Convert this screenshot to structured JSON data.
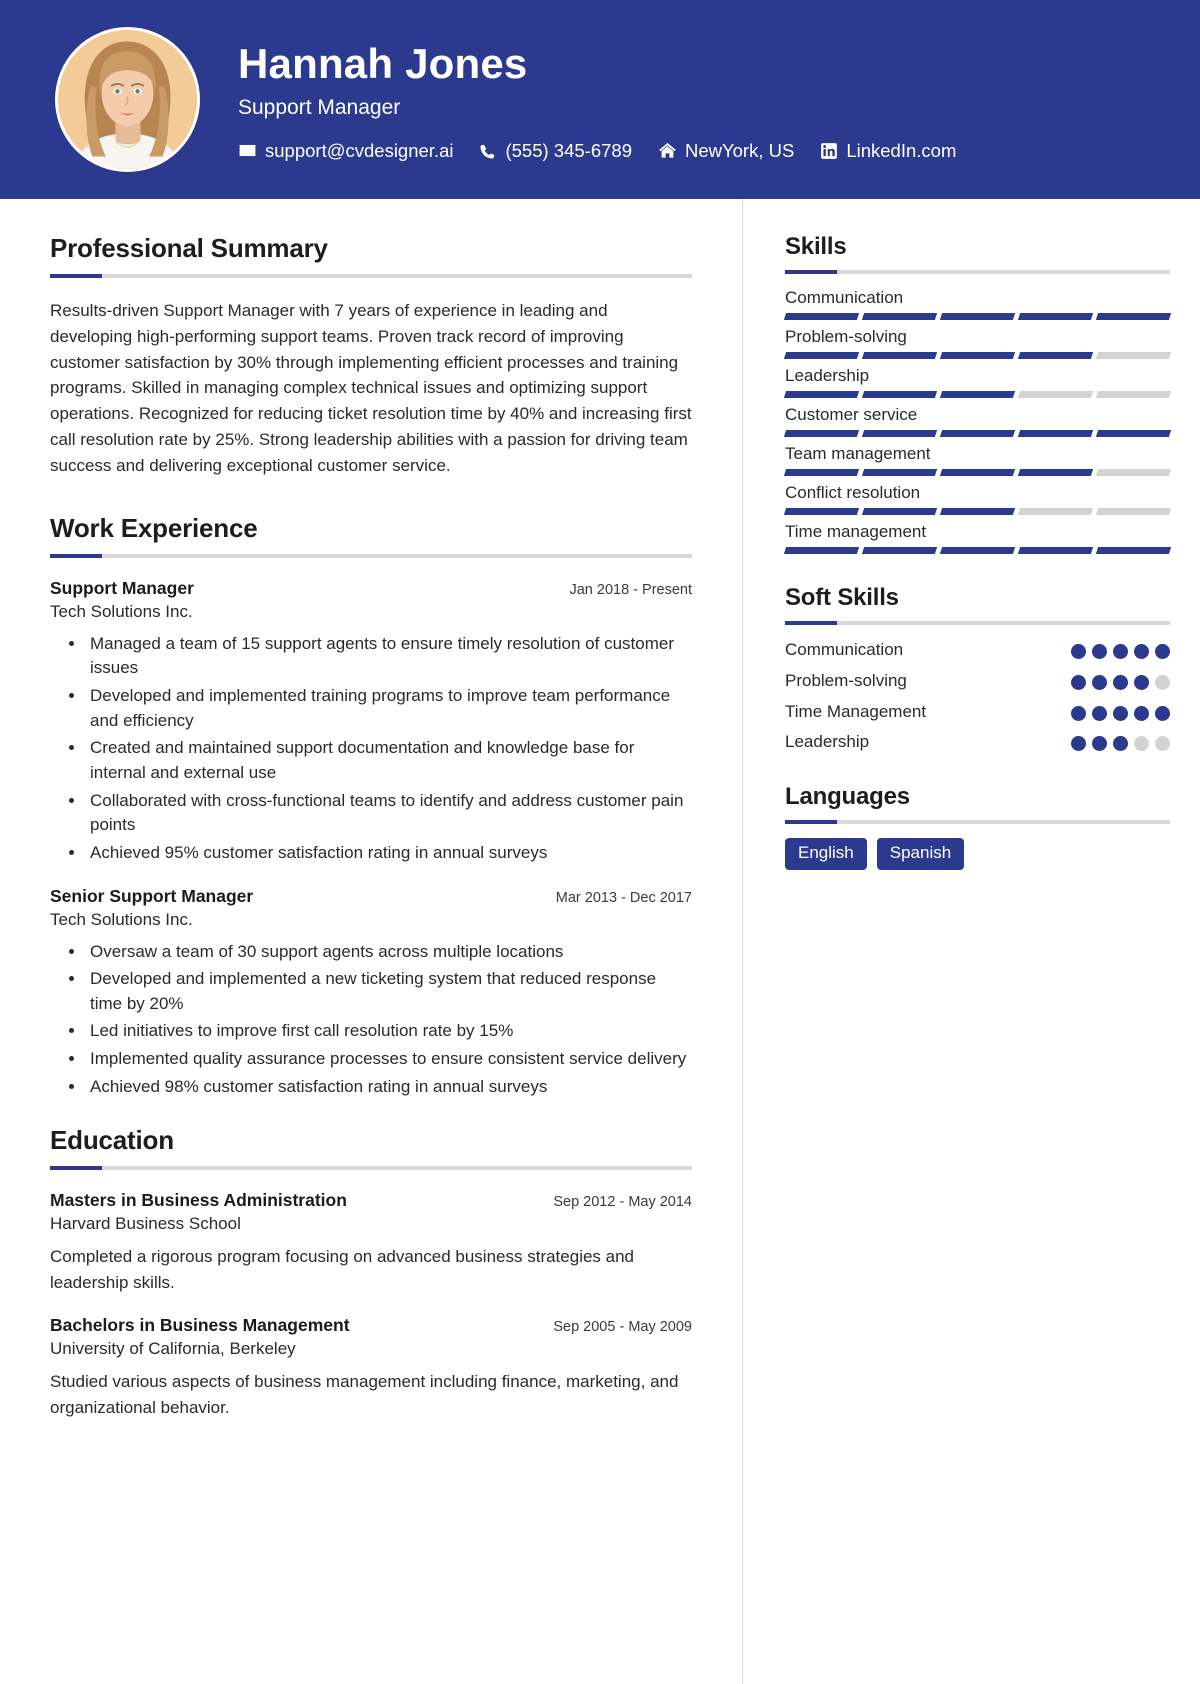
{
  "theme": {
    "primary": "#2b3a8f",
    "muted": "#d3d3d3",
    "text": "#2a2a2a"
  },
  "header": {
    "name": "Hannah Jones",
    "role": "Support Manager",
    "contacts": [
      {
        "icon": "envelope-icon",
        "text": "support@cvdesigner.ai"
      },
      {
        "icon": "phone-icon",
        "text": "(555) 345-6789"
      },
      {
        "icon": "home-icon",
        "text": "NewYork, US"
      },
      {
        "icon": "linkedin-icon",
        "text": "LinkedIn.com"
      }
    ]
  },
  "summary": {
    "title": "Professional Summary",
    "text": "Results-driven Support Manager with 7 years of experience in leading and developing high-performing support teams. Proven track record of improving customer satisfaction by 30% through implementing efficient processes and training programs. Skilled in managing complex technical issues and optimizing support operations. Recognized for reducing ticket resolution time by 40% and increasing first call resolution rate by 25%. Strong leadership abilities with a passion for driving team success and delivering exceptional customer service."
  },
  "experience": {
    "title": "Work Experience",
    "items": [
      {
        "title": "Support Manager",
        "date": "Jan 2018 - Present",
        "org": "Tech Solutions Inc.",
        "bullets": [
          "Managed a team of 15 support agents to ensure timely resolution of customer issues",
          "Developed and implemented training programs to improve team performance and efficiency",
          "Created and maintained support documentation and knowledge base for internal and external use",
          "Collaborated with cross-functional teams to identify and address customer pain points",
          "Achieved 95% customer satisfaction rating in annual surveys"
        ]
      },
      {
        "title": "Senior Support Manager",
        "date": "Mar 2013 - Dec 2017",
        "org": "Tech Solutions Inc.",
        "bullets": [
          "Oversaw a team of 30 support agents across multiple locations",
          "Developed and implemented a new ticketing system that reduced response time by 20%",
          "Led initiatives to improve first call resolution rate by 15%",
          "Implemented quality assurance processes to ensure consistent service delivery",
          "Achieved 98% customer satisfaction rating in annual surveys"
        ]
      }
    ]
  },
  "education": {
    "title": "Education",
    "items": [
      {
        "title": "Masters in Business Administration",
        "date": "Sep 2012 - May 2014",
        "org": "Harvard Business School",
        "desc": "Completed a rigorous program focusing on advanced business strategies and leadership skills."
      },
      {
        "title": "Bachelors in Business Management",
        "date": "Sep 2005 - May 2009",
        "org": "University of California, Berkeley",
        "desc": "Studied various aspects of business management including finance, marketing, and organizational behavior."
      }
    ]
  },
  "skills": {
    "title": "Skills",
    "max": 5,
    "items": [
      {
        "label": "Communication",
        "level": 5
      },
      {
        "label": "Problem-solving",
        "level": 4
      },
      {
        "label": "Leadership",
        "level": 3
      },
      {
        "label": "Customer service",
        "level": 5
      },
      {
        "label": "Team management",
        "level": 4
      },
      {
        "label": "Conflict resolution",
        "level": 3
      },
      {
        "label": "Time management",
        "level": 5
      }
    ]
  },
  "soft_skills": {
    "title": "Soft Skills",
    "max": 5,
    "items": [
      {
        "label": "Communication",
        "level": 5
      },
      {
        "label": "Problem-solving",
        "level": 4
      },
      {
        "label": "Time Management",
        "level": 5
      },
      {
        "label": "Leadership",
        "level": 3
      }
    ]
  },
  "languages": {
    "title": "Languages",
    "items": [
      "English",
      "Spanish"
    ]
  }
}
